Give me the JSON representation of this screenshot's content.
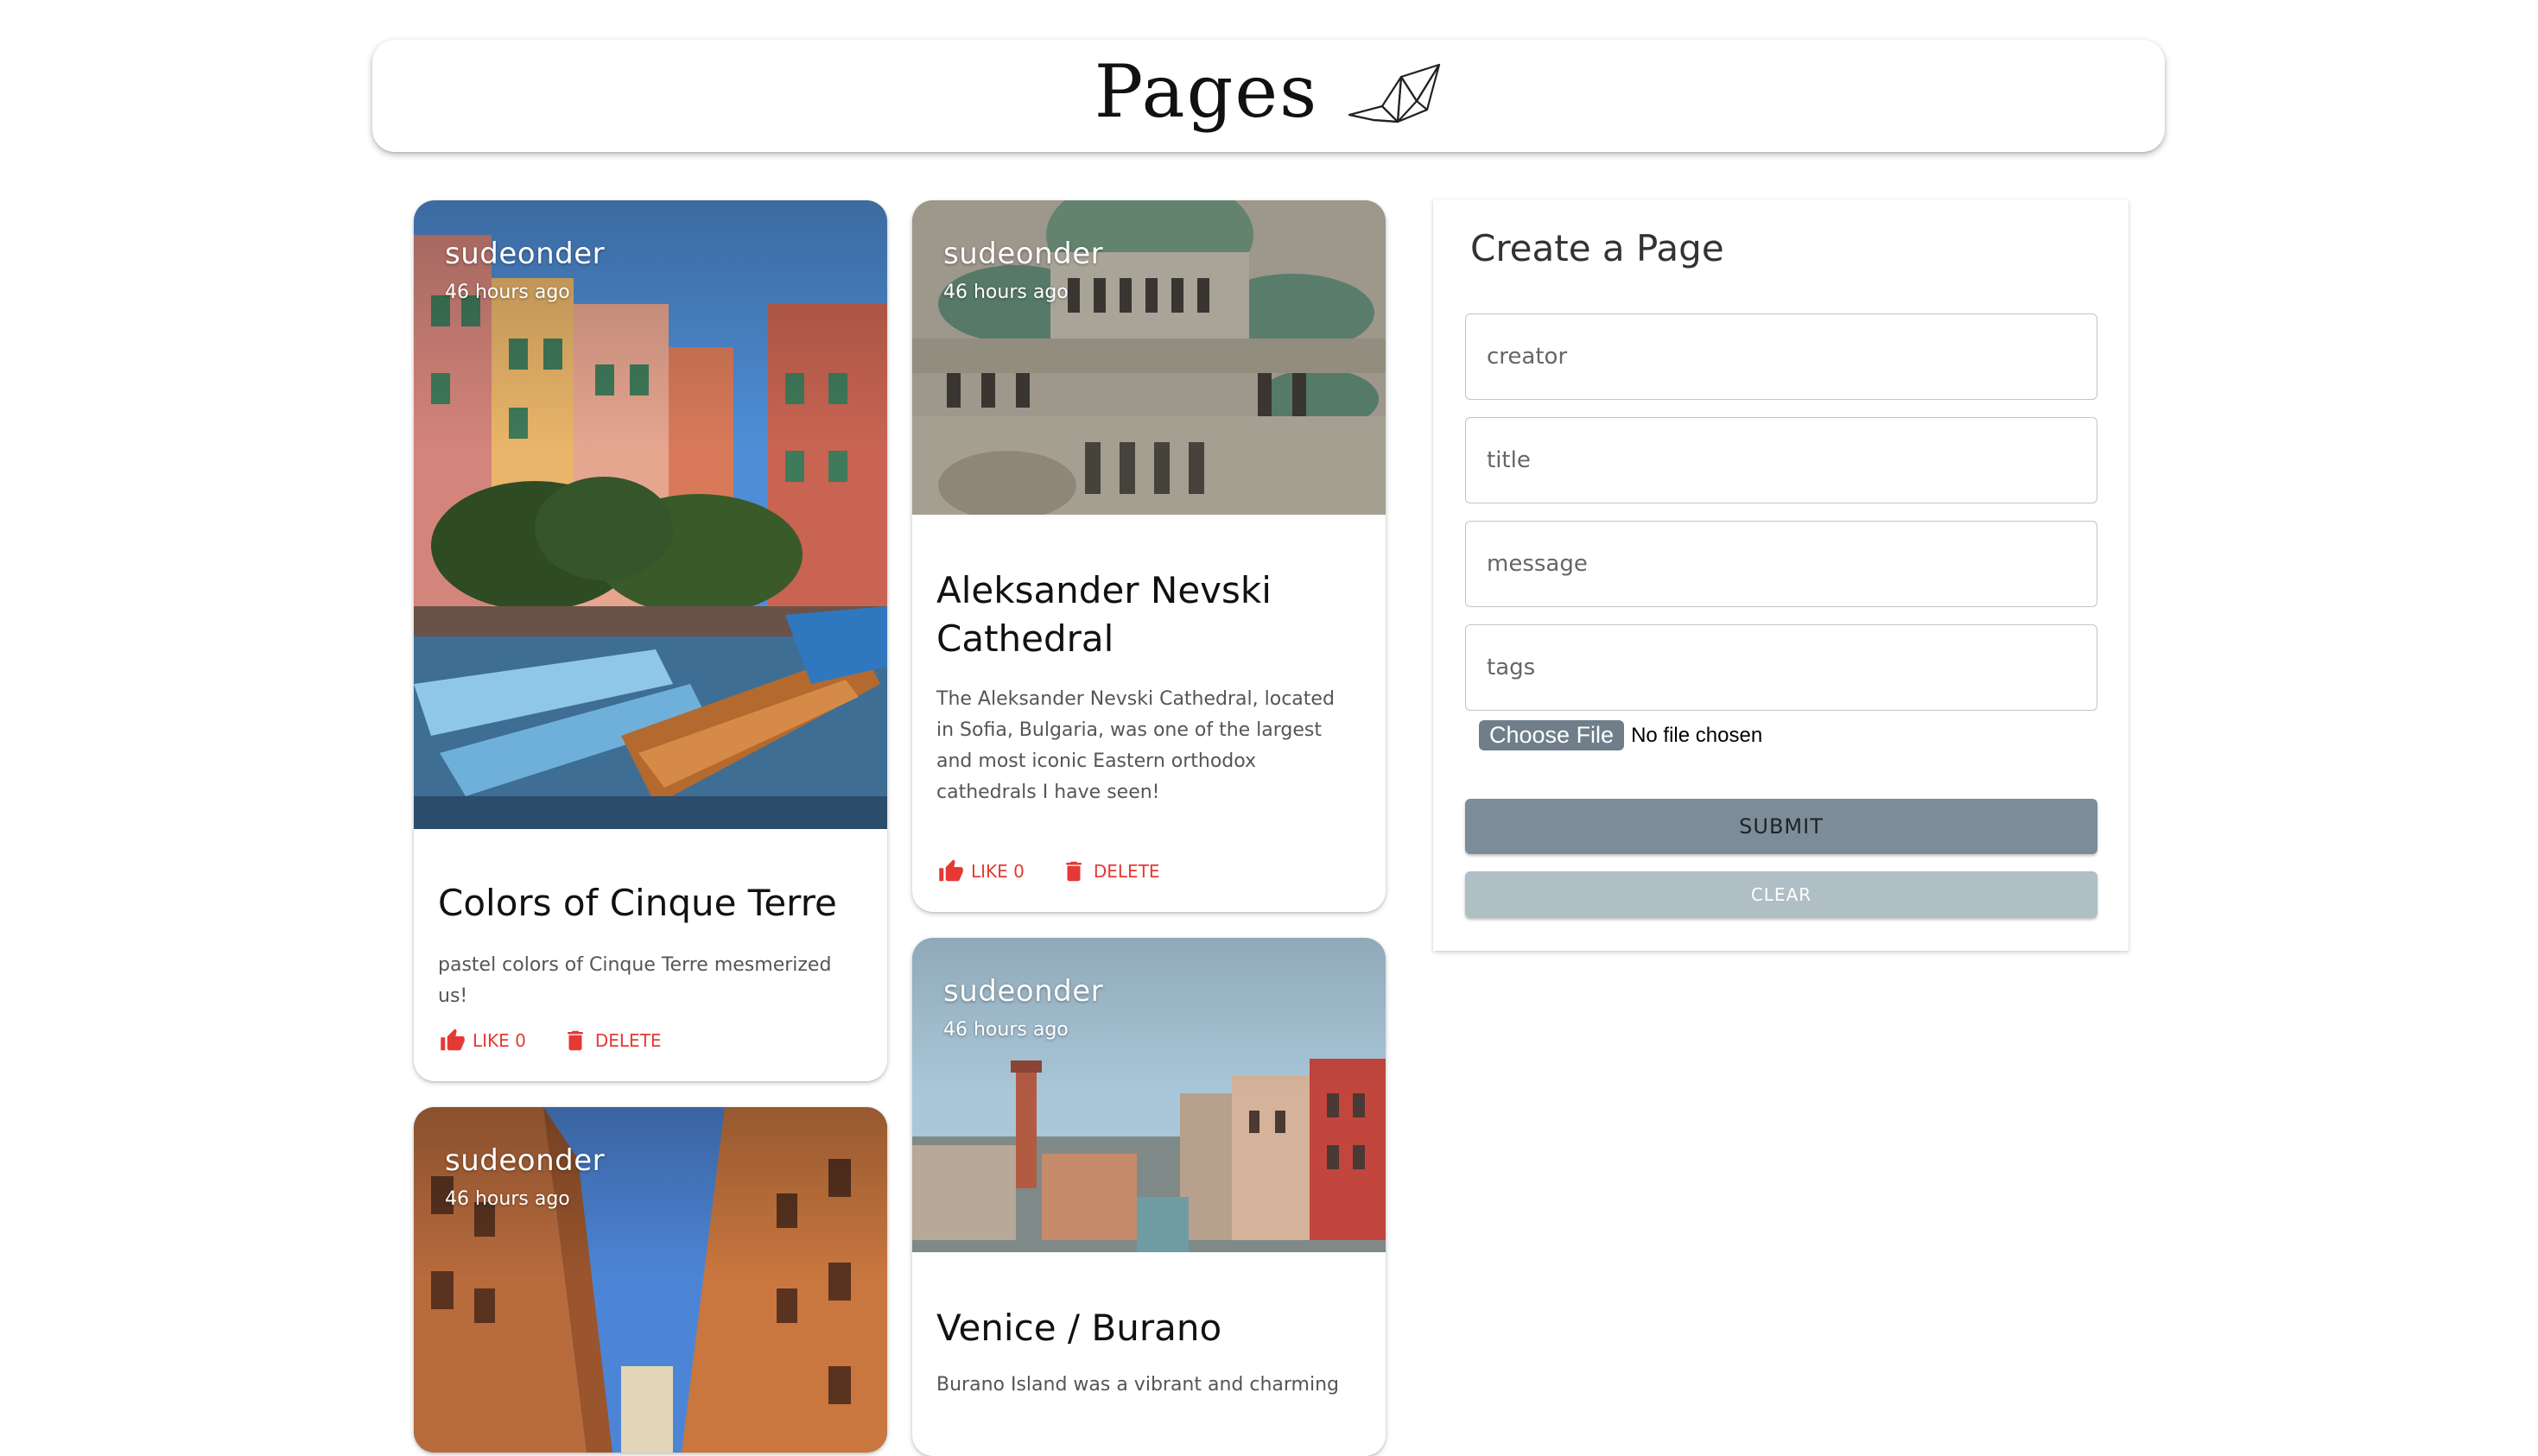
{
  "header": {
    "title": "Pages",
    "logo_icon": "paper-crane-icon"
  },
  "posts": [
    {
      "creator": "sudeonder",
      "time": "46 hours ago",
      "title": "Colors of Cinque Terre",
      "message": "pastel colors of Cinque Terre mesmerized us!",
      "like_label": "LIKE 0",
      "delete_label": "DELETE"
    },
    {
      "creator": "sudeonder",
      "time": "46 hours ago",
      "title": "Aleksander Nevski Cathedral",
      "message": "The Aleksander Nevski Cathedral, located in Sofia, Bulgaria, was one of the largest and most iconic Eastern orthodox cathedrals I have seen!",
      "like_label": "LIKE 0",
      "delete_label": "DELETE"
    },
    {
      "creator": "sudeonder",
      "time": "46 hours ago"
    },
    {
      "creator": "sudeonder",
      "time": "46 hours ago",
      "title": "Venice / Burano",
      "message": "Burano Island was a vibrant and charming"
    }
  ],
  "form": {
    "title": "Create a Page",
    "creator_placeholder": "creator",
    "title_placeholder": "title",
    "message_placeholder": "message",
    "tags_placeholder": "tags",
    "file_button": "Choose File",
    "file_status": "No file chosen",
    "submit_label": "SUBMIT",
    "clear_label": "CLEAR"
  },
  "colors": {
    "action_red": "#e53935",
    "submit_bg": "#7c8c99",
    "clear_bg": "#b0bec5"
  }
}
